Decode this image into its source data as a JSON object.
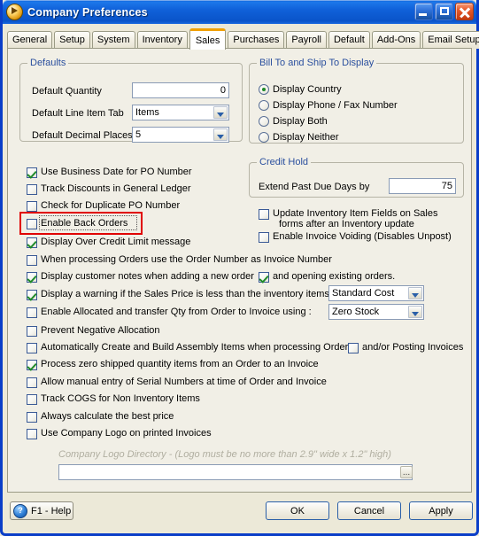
{
  "window": {
    "title": "Company Preferences",
    "icon": "company-play-icon",
    "buttons": {
      "minimize": "minimize-icon",
      "maximize": "maximize-icon",
      "close": "close-icon"
    },
    "accent_blue": "#0a3ec8",
    "active_tab_accent": "#f0a000",
    "highlight_color": "#e00000"
  },
  "tabs": [
    {
      "label": "General",
      "active": false
    },
    {
      "label": "Setup",
      "active": false
    },
    {
      "label": "System",
      "active": false
    },
    {
      "label": "Inventory",
      "active": false
    },
    {
      "label": "Sales",
      "active": true
    },
    {
      "label": "Purchases",
      "active": false
    },
    {
      "label": "Payroll",
      "active": false
    },
    {
      "label": "Default",
      "active": false
    },
    {
      "label": "Add-Ons",
      "active": false
    },
    {
      "label": "Email Setup",
      "active": false
    }
  ],
  "defaults_group": {
    "legend": "Defaults",
    "quantity_label": "Default Quantity",
    "quantity_value": "0",
    "line_item_tab_label": "Default Line Item Tab",
    "line_item_tab_value": "Items",
    "decimal_places_label": "Default Decimal Places",
    "decimal_places_value": "5"
  },
  "bill_ship_group": {
    "legend": "Bill To and Ship To Display",
    "options": [
      {
        "label": "Display Country",
        "selected": true
      },
      {
        "label": "Display Phone / Fax Number",
        "selected": false
      },
      {
        "label": "Display Both",
        "selected": false
      },
      {
        "label": "Display Neither",
        "selected": false
      }
    ]
  },
  "credit_hold_group": {
    "legend": "Credit Hold",
    "extend_label": "Extend Past Due Days by",
    "extend_value": "75"
  },
  "left_checks": [
    {
      "label": "Use Business Date for PO Number",
      "checked": true
    },
    {
      "label": "Track Discounts in General Ledger",
      "checked": false
    },
    {
      "label": "Check for Duplicate PO Number",
      "checked": false
    },
    {
      "label": "Enable Back Orders",
      "checked": false,
      "highlighted": true,
      "focused": true
    },
    {
      "label": "Display Over Credit Limit message",
      "checked": true
    }
  ],
  "right_checks": [
    {
      "label": "Update Inventory Item Fields on Sales",
      "checked": false
    },
    {
      "label": "forms after an Inventory update",
      "checked": null
    },
    {
      "label": "Enable Invoice Voiding (Disables Unpost)",
      "checked": false
    }
  ],
  "wide_rows": {
    "order_number_as_invoice": {
      "label": "When processing Orders use the Order Number as Invoice Number",
      "checked": false
    },
    "customer_notes": {
      "label": "Display customer notes when adding a new order",
      "checked": true
    },
    "opening_existing": {
      "label": "and opening existing orders.",
      "checked": true
    },
    "sales_price_warning": {
      "label": "Display a warning if the Sales Price is less than the inventory items",
      "checked": true,
      "combo_value": "Standard Cost"
    },
    "enable_allocated": {
      "label": "Enable Allocated and transfer Qty from Order to Invoice using :",
      "checked": false,
      "combo_value": "Zero Stock"
    },
    "prevent_negative": {
      "label": "Prevent Negative Allocation",
      "checked": false
    },
    "auto_assembly": {
      "label": "Automatically Create and Build Assembly Items when processing Orders",
      "checked": false
    },
    "posting_invoices": {
      "label": "and/or Posting Invoices",
      "checked": false
    },
    "zero_shipped": {
      "label": "Process zero shipped quantity items from an Order to an Invoice",
      "checked": true
    },
    "manual_serial": {
      "label": "Allow manual entry of Serial Numbers at time of Order and Invoice",
      "checked": false
    },
    "track_cogs": {
      "label": "Track COGS for Non Inventory Items",
      "checked": false
    },
    "best_price": {
      "label": "Always calculate the best price",
      "checked": false
    },
    "company_logo": {
      "label": "Use Company Logo on printed Invoices",
      "checked": false
    }
  },
  "logo": {
    "hint": "Company Logo Directory - (Logo must be no more than 2.9\" wide x 1.2\" high)",
    "path_value": "",
    "browse_label": "..."
  },
  "footer": {
    "help_label": "F1 - Help",
    "help_icon": "question-mark-icon",
    "ok_label": "OK",
    "cancel_label": "Cancel",
    "apply_label": "Apply"
  }
}
